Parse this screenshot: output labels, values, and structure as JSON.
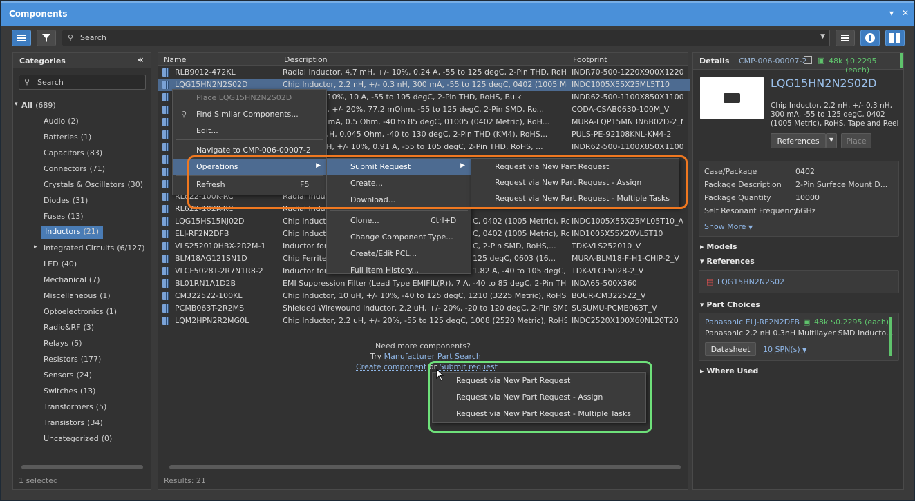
{
  "title": "Components",
  "titlebar": {
    "dropdown_glyph": "▾",
    "close_glyph": "✕"
  },
  "toolbar": {
    "search_placeholder": "Search",
    "menu_icon": "list-icon",
    "filter_icon": "filter-icon",
    "info_icon": "info-icon",
    "layout_icon": "layout-icon"
  },
  "categories": {
    "header": "Categories",
    "collapse": "«",
    "search_placeholder": "Search",
    "items": [
      {
        "label": "All",
        "count": "(689)",
        "expanded": true
      },
      {
        "label": "Audio",
        "count": "(2)"
      },
      {
        "label": "Batteries",
        "count": "(1)"
      },
      {
        "label": "Capacitors",
        "count": "(83)"
      },
      {
        "label": "Connectors",
        "count": "(71)"
      },
      {
        "label": "Crystals & Oscillators",
        "count": "(30)"
      },
      {
        "label": "Diodes",
        "count": "(31)"
      },
      {
        "label": "Fuses",
        "count": "(13)"
      },
      {
        "label": "Inductors",
        "count": "(21)",
        "selected": true
      },
      {
        "label": "Integrated Circuits",
        "count": "(6/127)",
        "has_children": true
      },
      {
        "label": "LED",
        "count": "(40)"
      },
      {
        "label": "Mechanical",
        "count": "(7)"
      },
      {
        "label": "Miscellaneous",
        "count": "(1)"
      },
      {
        "label": "Optoelectronics",
        "count": "(1)"
      },
      {
        "label": "Radio&RF",
        "count": "(3)"
      },
      {
        "label": "Relays",
        "count": "(5)"
      },
      {
        "label": "Resistors",
        "count": "(177)"
      },
      {
        "label": "Sensors",
        "count": "(24)"
      },
      {
        "label": "Switches",
        "count": "(13)"
      },
      {
        "label": "Transformers",
        "count": "(5)"
      },
      {
        "label": "Transistors",
        "count": "(34)"
      },
      {
        "label": "Uncategorized",
        "count": "(0)"
      }
    ],
    "status": "1 selected"
  },
  "grid": {
    "columns": [
      "Name",
      "Description",
      "Footprint"
    ],
    "rows": [
      {
        "name": "RLB9012-472KL",
        "desc": "Radial Inductor, 4.7 mH, +/- 10%, 0.24 A, -55 to 125 degC, 2-Pin THD, RoHS, Bulk",
        "fp": "INDR70-500-1220X900X1220"
      },
      {
        "name": "LQG15HN2N2S02D",
        "desc": "Chip Inductor, 2.2 nH, +/- 0.3 nH, 300 mA, -55 to 125 degC, 0402 (1005 Metric),...",
        "fp": "INDC1005X55X25ML5T10",
        "selected": true
      },
      {
        "name": "",
        "desc": "r, 1 uH, +/- 10%, 10 A, -55 to 105 degC, 2-Pin THD, RoHS, Bulk",
        "fp": "INDR62-500-1100X850X1100"
      },
      {
        "name": "",
        "desc": "ictor, 10 uH, +/- 20%, 77.2 mOhm, -55 to 125 degC, 2-Pin SMD, Ro...",
        "fp": "CODA-CSAB0630-100M_V"
      },
      {
        "name": "",
        "desc": "0 MHz, 170 mA, 0.5 Ohm, -40 to 85 degC, 01005 (0402 Metric), RoH...",
        "fp": "MURA-LQP15MN3N6B02D-2_M"
      },
      {
        "name": "",
        "desc": "ductor, 67 uH, 0.045 Ohm, -40 to 130 degC, 2-Pin THD (KM4), RoHS...",
        "fp": "PULS-PE-92108KNL-KM4-2"
      },
      {
        "name": "",
        "desc": "ictor, 100 uH, +/- 10%, 0.91 A, -55 to 105 degC, 2-Pin THD, RoHS, ...",
        "fp": "INDR62-500-1100X850X1100"
      },
      {
        "name": "",
        "desc": "",
        "fp": ""
      },
      {
        "name": "",
        "desc": "",
        "fp": ""
      },
      {
        "name": "",
        "desc": "",
        "fp": ""
      },
      {
        "name": "RL622-100K-RC",
        "desc": "Radial Induc",
        "fp": ""
      },
      {
        "name": "RL622-102K-RC",
        "desc": "Radial Induc",
        "fp": ""
      },
      {
        "name": "LQG15HS15NJ02D",
        "desc": "Chip Inducto",
        "fp": "INDC1005X55X25ML05T10_A",
        "desc_tail": "C, 0402 (1005 Metric), Ro..."
      },
      {
        "name": "ELJ-RF2N2DFB",
        "desc": "Chip Inducto",
        "fp": "IND1005X55X20VL5T10",
        "desc_tail": "C, 0402 (1005 Metric), Ro..."
      },
      {
        "name": "VLS252010HBX-2R2M-1",
        "desc": "Inductor for",
        "fp": "TDK-VLS252010_V",
        "desc_tail": "C, 2-Pin SMD, RoHS,..."
      },
      {
        "name": "BLM18AG121SN1D",
        "desc": "Chip Ferrite",
        "fp": "MURA-BLM18-F-H1-CHIP-2_V",
        "desc_tail": "125 degC, 0603 (16..."
      },
      {
        "name": "VLCF5028T-2R7N1R8-2",
        "desc": "Inductor for",
        "fp": "TDK-VLCF5028-2_V",
        "desc_tail": "1.82 A, -40 to 105 degC, 2..."
      },
      {
        "name": "BL01RN1A1D2B",
        "desc": "EMI Suppression Filter (Lead Type EMIFIL(R)), 7 A, -40 to 85 degC, 2-Pin THD, RoHS...",
        "fp": "INDA65-500X360"
      },
      {
        "name": "CM322522-100KL",
        "desc": "Chip Inductor, 10 uH, +/- 10%, -40 to 125 degC, 1210 (3225 Metric), RoHS, Tape...",
        "fp": "BOUR-CM322522_V"
      },
      {
        "name": "PCMB063T-2R2MS",
        "desc": "Shielded Wirewound Inductor, 2.2 uH, +/- 20%, -20 to 120 degC, 2-Pin SMD, RoHS...",
        "fp": "SUSUMU-PCMB063T_V"
      },
      {
        "name": "LQM2HPN2R2MG0L",
        "desc": "Chip Inductor, 2.2 uH, +/- 20%, -55 to 125 degC, 1008 (2520 Metric), RoHS, Tap...",
        "fp": "INDC2520X100X60NL20T20"
      }
    ],
    "more_text": "Need more components?",
    "try_text": "Try",
    "mfr_link": "Manufacturer Part Search",
    "create_link": "Create component",
    "or_text": "or",
    "submit_link": "Submit request",
    "results": "Results: 21"
  },
  "context_menu": {
    "items": [
      {
        "label": "Place LQG15HN2N2S02D",
        "disabled": true
      },
      {
        "label": "Find Similar Components...",
        "icon": "search-icon"
      },
      {
        "label": "Edit..."
      },
      {
        "label": "Navigate to CMP-006-00007-2"
      },
      {
        "label": "Operations",
        "submenu": true
      },
      {
        "label": "Refresh",
        "shortcut": "F5"
      }
    ]
  },
  "operations_menu": {
    "items": [
      {
        "label": "Submit Request",
        "submenu": true
      },
      {
        "label": "Create..."
      },
      {
        "label": "Download..."
      },
      {
        "label": "Clone...",
        "shortcut": "Ctrl+D"
      },
      {
        "label": "Change Component Type..."
      },
      {
        "label": "Create/Edit PCL..."
      },
      {
        "label": "Full Item History..."
      }
    ]
  },
  "submit_menu": {
    "items": [
      "Request via New Part Request",
      "Request via New Part Request - Assign",
      "Request via New Part Request - Multiple Tasks"
    ]
  },
  "popup_menu": {
    "items": [
      "Request via New Part Request",
      "Request via New Part Request - Assign",
      "Request via New Part Request - Multiple Tasks"
    ]
  },
  "details": {
    "header": "Details",
    "cmp": "CMP-006-00007-2",
    "stock": "48k",
    "price": "$0.2295 (each)",
    "part": "LQG15HN2N2S02D",
    "description": "Chip Inductor, 2.2 nH, +/- 0.3 nH, 300 mA, -55 to 125 degC, 0402 (1005 Metric), RoHS, Tape and Reel",
    "references_btn": "References",
    "place_btn": "Place",
    "params": [
      {
        "k": "Case/Package",
        "v": "0402"
      },
      {
        "k": "Package Description",
        "v": "2-Pin Surface Mount D..."
      },
      {
        "k": "Package Quantity",
        "v": "10000"
      },
      {
        "k": "Self Resonant Frequency",
        "v": "6GHz"
      }
    ],
    "show_more": "Show More",
    "models": "Models",
    "references": "References",
    "ref_item": "LQG15HN2N2S02",
    "part_choices": "Part Choices",
    "choice_mfr": "Panasonic ELJ-RF2N2DFB",
    "choice_stock": "48k",
    "choice_price": "$0.2295 (each)",
    "choice_desc": "Panasonic 2.2 nH 0.3nH Multilayer SMD Inducto...",
    "datasheet_btn": "Datasheet",
    "spn": "10 SPN(s)",
    "where_used": "Where Used"
  },
  "colors": {
    "accent": "#4a90d9",
    "selection": "#4d6b91",
    "orange": "#f07820",
    "green": "#6ee07a"
  }
}
